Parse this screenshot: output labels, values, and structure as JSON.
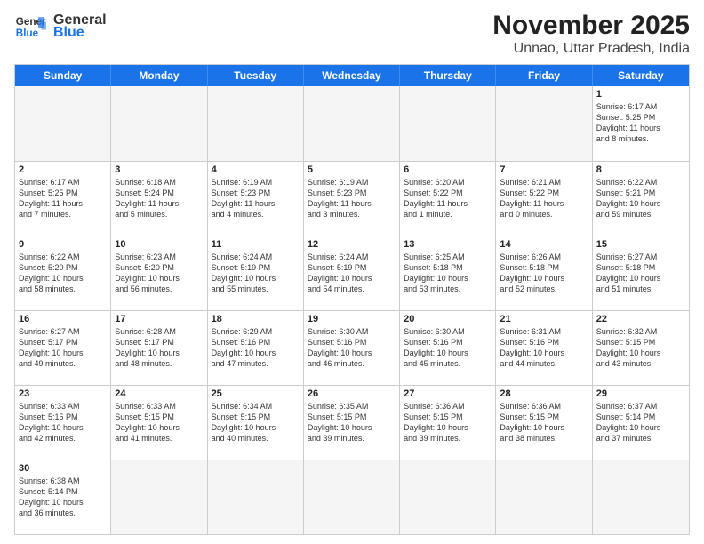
{
  "logo": {
    "general": "General",
    "blue": "Blue"
  },
  "title": "November 2025",
  "subtitle": "Unnao, Uttar Pradesh, India",
  "header_days": [
    "Sunday",
    "Monday",
    "Tuesday",
    "Wednesday",
    "Thursday",
    "Friday",
    "Saturday"
  ],
  "weeks": [
    [
      {
        "day": "",
        "info": ""
      },
      {
        "day": "",
        "info": ""
      },
      {
        "day": "",
        "info": ""
      },
      {
        "day": "",
        "info": ""
      },
      {
        "day": "",
        "info": ""
      },
      {
        "day": "",
        "info": ""
      },
      {
        "day": "1",
        "info": "Sunrise: 6:17 AM\nSunset: 5:25 PM\nDaylight: 11 hours\nand 8 minutes."
      }
    ],
    [
      {
        "day": "2",
        "info": "Sunrise: 6:17 AM\nSunset: 5:25 PM\nDaylight: 11 hours\nand 7 minutes."
      },
      {
        "day": "3",
        "info": "Sunrise: 6:18 AM\nSunset: 5:24 PM\nDaylight: 11 hours\nand 5 minutes."
      },
      {
        "day": "4",
        "info": "Sunrise: 6:19 AM\nSunset: 5:23 PM\nDaylight: 11 hours\nand 4 minutes."
      },
      {
        "day": "5",
        "info": "Sunrise: 6:19 AM\nSunset: 5:23 PM\nDaylight: 11 hours\nand 3 minutes."
      },
      {
        "day": "6",
        "info": "Sunrise: 6:20 AM\nSunset: 5:22 PM\nDaylight: 11 hours\nand 1 minute."
      },
      {
        "day": "7",
        "info": "Sunrise: 6:21 AM\nSunset: 5:22 PM\nDaylight: 11 hours\nand 0 minutes."
      },
      {
        "day": "8",
        "info": "Sunrise: 6:22 AM\nSunset: 5:21 PM\nDaylight: 10 hours\nand 59 minutes."
      }
    ],
    [
      {
        "day": "9",
        "info": "Sunrise: 6:22 AM\nSunset: 5:20 PM\nDaylight: 10 hours\nand 58 minutes."
      },
      {
        "day": "10",
        "info": "Sunrise: 6:23 AM\nSunset: 5:20 PM\nDaylight: 10 hours\nand 56 minutes."
      },
      {
        "day": "11",
        "info": "Sunrise: 6:24 AM\nSunset: 5:19 PM\nDaylight: 10 hours\nand 55 minutes."
      },
      {
        "day": "12",
        "info": "Sunrise: 6:24 AM\nSunset: 5:19 PM\nDaylight: 10 hours\nand 54 minutes."
      },
      {
        "day": "13",
        "info": "Sunrise: 6:25 AM\nSunset: 5:18 PM\nDaylight: 10 hours\nand 53 minutes."
      },
      {
        "day": "14",
        "info": "Sunrise: 6:26 AM\nSunset: 5:18 PM\nDaylight: 10 hours\nand 52 minutes."
      },
      {
        "day": "15",
        "info": "Sunrise: 6:27 AM\nSunset: 5:18 PM\nDaylight: 10 hours\nand 51 minutes."
      }
    ],
    [
      {
        "day": "16",
        "info": "Sunrise: 6:27 AM\nSunset: 5:17 PM\nDaylight: 10 hours\nand 49 minutes."
      },
      {
        "day": "17",
        "info": "Sunrise: 6:28 AM\nSunset: 5:17 PM\nDaylight: 10 hours\nand 48 minutes."
      },
      {
        "day": "18",
        "info": "Sunrise: 6:29 AM\nSunset: 5:16 PM\nDaylight: 10 hours\nand 47 minutes."
      },
      {
        "day": "19",
        "info": "Sunrise: 6:30 AM\nSunset: 5:16 PM\nDaylight: 10 hours\nand 46 minutes."
      },
      {
        "day": "20",
        "info": "Sunrise: 6:30 AM\nSunset: 5:16 PM\nDaylight: 10 hours\nand 45 minutes."
      },
      {
        "day": "21",
        "info": "Sunrise: 6:31 AM\nSunset: 5:16 PM\nDaylight: 10 hours\nand 44 minutes."
      },
      {
        "day": "22",
        "info": "Sunrise: 6:32 AM\nSunset: 5:15 PM\nDaylight: 10 hours\nand 43 minutes."
      }
    ],
    [
      {
        "day": "23",
        "info": "Sunrise: 6:33 AM\nSunset: 5:15 PM\nDaylight: 10 hours\nand 42 minutes."
      },
      {
        "day": "24",
        "info": "Sunrise: 6:33 AM\nSunset: 5:15 PM\nDaylight: 10 hours\nand 41 minutes."
      },
      {
        "day": "25",
        "info": "Sunrise: 6:34 AM\nSunset: 5:15 PM\nDaylight: 10 hours\nand 40 minutes."
      },
      {
        "day": "26",
        "info": "Sunrise: 6:35 AM\nSunset: 5:15 PM\nDaylight: 10 hours\nand 39 minutes."
      },
      {
        "day": "27",
        "info": "Sunrise: 6:36 AM\nSunset: 5:15 PM\nDaylight: 10 hours\nand 39 minutes."
      },
      {
        "day": "28",
        "info": "Sunrise: 6:36 AM\nSunset: 5:15 PM\nDaylight: 10 hours\nand 38 minutes."
      },
      {
        "day": "29",
        "info": "Sunrise: 6:37 AM\nSunset: 5:14 PM\nDaylight: 10 hours\nand 37 minutes."
      }
    ],
    [
      {
        "day": "30",
        "info": "Sunrise: 6:38 AM\nSunset: 5:14 PM\nDaylight: 10 hours\nand 36 minutes."
      },
      {
        "day": "",
        "info": ""
      },
      {
        "day": "",
        "info": ""
      },
      {
        "day": "",
        "info": ""
      },
      {
        "day": "",
        "info": ""
      },
      {
        "day": "",
        "info": ""
      },
      {
        "day": "",
        "info": ""
      }
    ]
  ]
}
